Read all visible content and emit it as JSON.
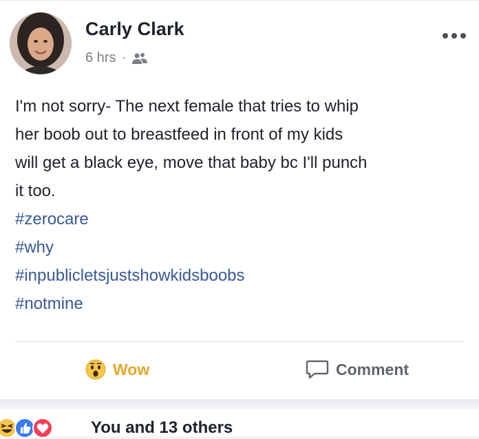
{
  "post": {
    "author": "Carly Clark",
    "time": "6 hrs",
    "separator": "·",
    "audience_icon": "friends-icon",
    "more_icon": "more-options-icon",
    "text_lines": [
      "I'm not sorry- The next female that tries to whip",
      "her boob out to breastfeed in front of my kids",
      "will get a black eye, move that baby bc I'll punch",
      "it too."
    ],
    "hashtags": [
      "#zerocare",
      "#why",
      "#inpublicletsjustshowkidsboobs",
      "#notmine"
    ]
  },
  "actions": {
    "wow_label": "Wow",
    "comment_label": "Comment"
  },
  "reactions": {
    "icons": [
      "haha-reaction-icon",
      "like-reaction-icon",
      "love-reaction-icon"
    ],
    "summary": "You and 13 others"
  },
  "colors": {
    "hashtag": "#385898",
    "wow": "#e7a62e",
    "muted": "#7a7f87"
  }
}
